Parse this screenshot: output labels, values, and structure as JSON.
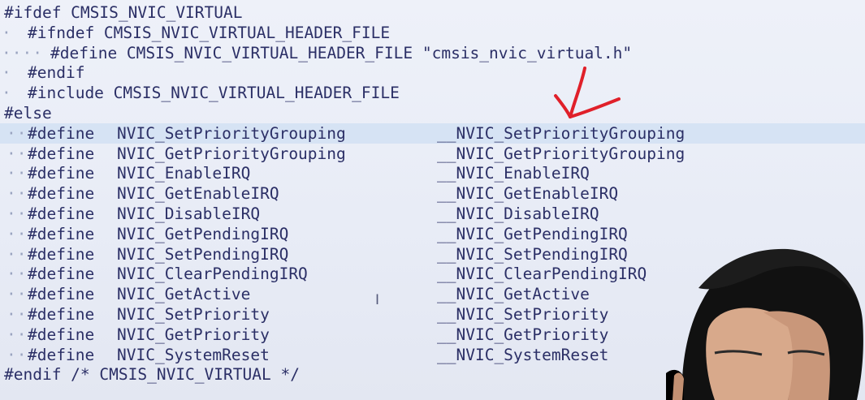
{
  "editor": {
    "lines": [
      {
        "indent": "",
        "text": "#ifdef CMSIS_NVIC_VIRTUAL"
      },
      {
        "indent": "· ",
        "text": "#ifndef CMSIS_NVIC_VIRTUAL_HEADER_FILE"
      },
      {
        "indent": "····",
        "text": "#define CMSIS_NVIC_VIRTUAL_HEADER_FILE \"cmsis_nvic_virtual.h\""
      },
      {
        "indent": "· ",
        "text": "#endif"
      },
      {
        "indent": "· ",
        "text": "#include CMSIS_NVIC_VIRTUAL_HEADER_FILE"
      },
      {
        "indent": "",
        "text": "#else"
      }
    ],
    "define_lines": [
      {
        "name": "NVIC_SetPriorityGrouping",
        "target": "__NVIC_SetPriorityGrouping"
      },
      {
        "name": "NVIC_GetPriorityGrouping",
        "target": "__NVIC_GetPriorityGrouping"
      },
      {
        "name": "NVIC_EnableIRQ",
        "target": "__NVIC_EnableIRQ"
      },
      {
        "name": "NVIC_GetEnableIRQ",
        "target": "__NVIC_GetEnableIRQ"
      },
      {
        "name": "NVIC_DisableIRQ",
        "target": "__NVIC_DisableIRQ"
      },
      {
        "name": "NVIC_GetPendingIRQ",
        "target": "__NVIC_GetPendingIRQ"
      },
      {
        "name": "NVIC_SetPendingIRQ",
        "target": "__NVIC_SetPendingIRQ"
      },
      {
        "name": "NVIC_ClearPendingIRQ",
        "target": "__NVIC_ClearPendingIRQ"
      },
      {
        "name": "NVIC_GetActive",
        "target": "__NVIC_GetActive"
      },
      {
        "name": "NVIC_SetPriority",
        "target": "__NVIC_SetPriority"
      },
      {
        "name": "NVIC_GetPriority",
        "target": "__NVIC_GetPriority"
      },
      {
        "name": "NVIC_SystemReset",
        "target": "__NVIC_SystemReset"
      }
    ],
    "define_keyword": "#define",
    "define_indent": "··",
    "closing_line": "#endif /* CMSIS_NVIC_VIRTUAL */",
    "highlighted_define_index": 0
  },
  "colors": {
    "text": "#2b2f66",
    "whitespace_dots": "#9aa4c0",
    "highlight": "#d6e3f4",
    "annotation_arrow": "#e0202a"
  },
  "annotation": {
    "icon": "arrow-icon"
  },
  "cursor": {
    "icon": "text-cursor-icon",
    "glyph": "I"
  }
}
